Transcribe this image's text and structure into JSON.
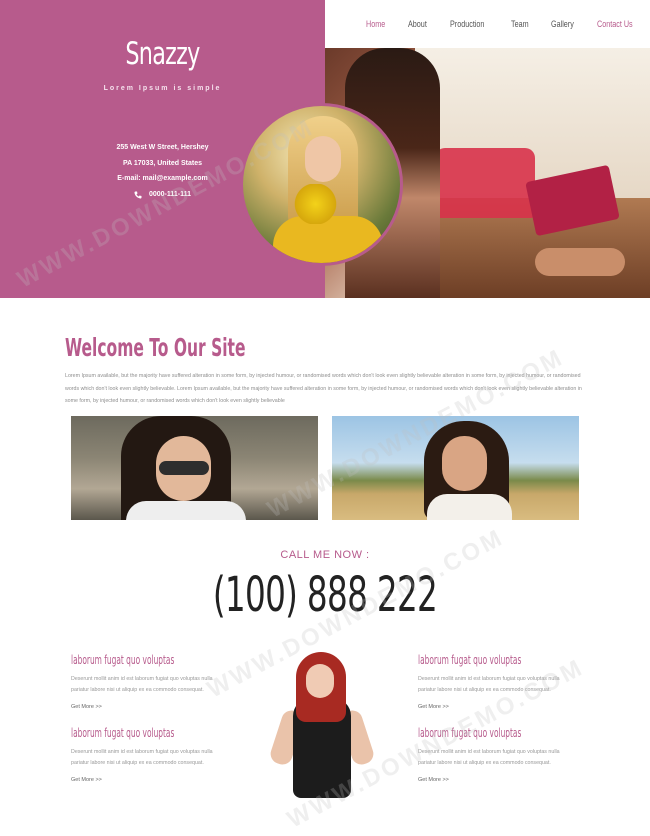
{
  "brand": {
    "logo": "Snazzy",
    "tagline": "Lorem Ipsum is simple"
  },
  "address": {
    "line1": "255 West W Street, Hershey",
    "line2": "PA 17033, United States",
    "email": "E-mail: mail@example.com",
    "phone": "0000-111-111"
  },
  "nav": {
    "items": [
      {
        "label": "Home",
        "active": true
      },
      {
        "label": "About",
        "active": false
      },
      {
        "label": "Production",
        "active": false
      },
      {
        "label": "Team",
        "active": false
      },
      {
        "label": "Gallery",
        "active": false
      },
      {
        "label": "Contact Us",
        "active": false
      }
    ]
  },
  "welcome": {
    "title": "Welcome To Our Site",
    "text": "Lorem Ipsum available, but the majority have suffered alteration in some form, by injected humour, or randomised words which don't look even slightly believable alteration in some form, by injected humour, or randomised words which don't look even slightly believable. Lorem Ipsum available, but the majority have suffered alteration in some form, by injected humour, or randomised words which don't look even slightly believable alteration in some form, by injected humour, or randomised words which don't look even slightly believable"
  },
  "call": {
    "label": "CALL ME NOW :",
    "number": "(100) 888 222"
  },
  "features": [
    {
      "title": "laborum fugat quo voluptas",
      "text": "Deserunt mollit anim id est laborum fugiat quo voluptas nulla pariatur labore nisi ut aliquip ex ea commodo consequat.",
      "link": "Get More >>"
    },
    {
      "title": "laborum fugat quo voluptas",
      "text": "Deserunt mollit anim id est laborum fugiat quo voluptas nulla pariatur labore nisi ut aliquip ex ea commodo consequat.",
      "link": "Get More >>"
    },
    {
      "title": "laborum fugat quo voluptas",
      "text": "Deserunt mollit anim id est laborum fugiat quo voluptas nulla pariatur labore nisi ut aliquip ex ea commodo consequat.",
      "link": "Get More >>"
    },
    {
      "title": "laborum fugat quo voluptas",
      "text": "Deserunt mollit anim id est laborum fugiat quo voluptas nulla pariatur labore nisi ut aliquip ex ea commodo consequat.",
      "link": "Get More >>"
    }
  ],
  "watermark": "WWW.DOWNDEMO.COM",
  "colors": {
    "accent": "#b75b8c",
    "text": "#777777",
    "heading": "#222222"
  }
}
